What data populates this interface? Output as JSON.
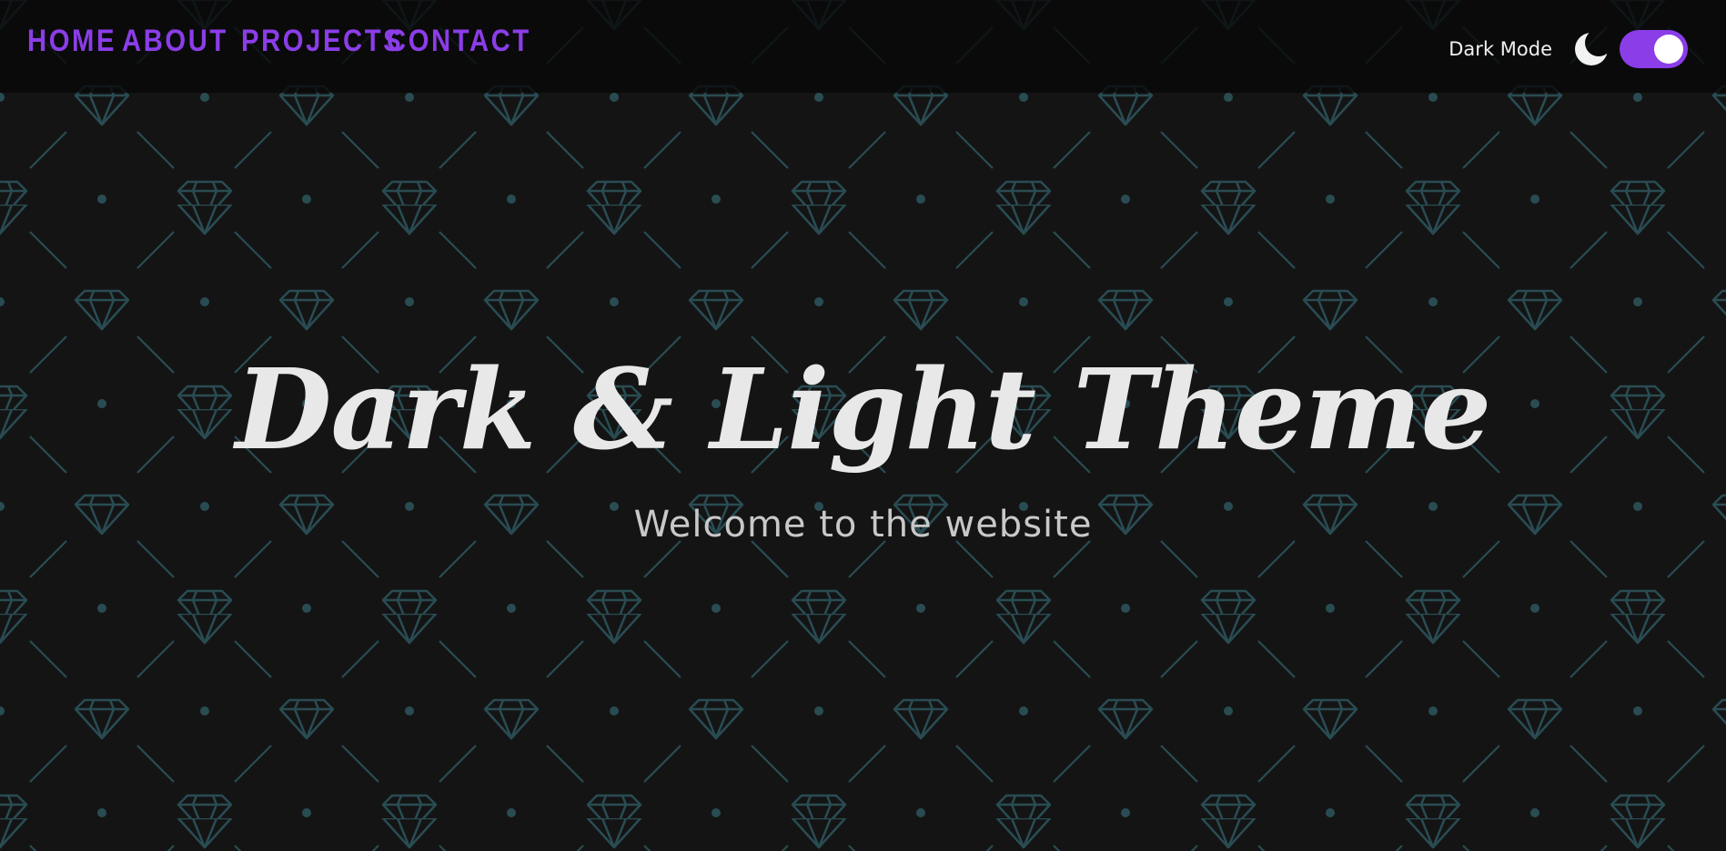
{
  "nav": {
    "links": [
      {
        "label": "HOME"
      },
      {
        "label": "ABOUT"
      },
      {
        "label": "PROJECTS"
      },
      {
        "label": "CONTACT"
      }
    ]
  },
  "theme": {
    "label": "Dark Mode",
    "toggle_on": true,
    "accent_color": "#8b3de8",
    "icon": "moon-icon"
  },
  "hero": {
    "title": "Dark & Light Theme",
    "subtitle": "Welcome to the website"
  },
  "colors": {
    "background": "#141414",
    "pattern": "#294c53",
    "nav_text": "#8b3de8",
    "title_text": "#e8e8e8"
  }
}
